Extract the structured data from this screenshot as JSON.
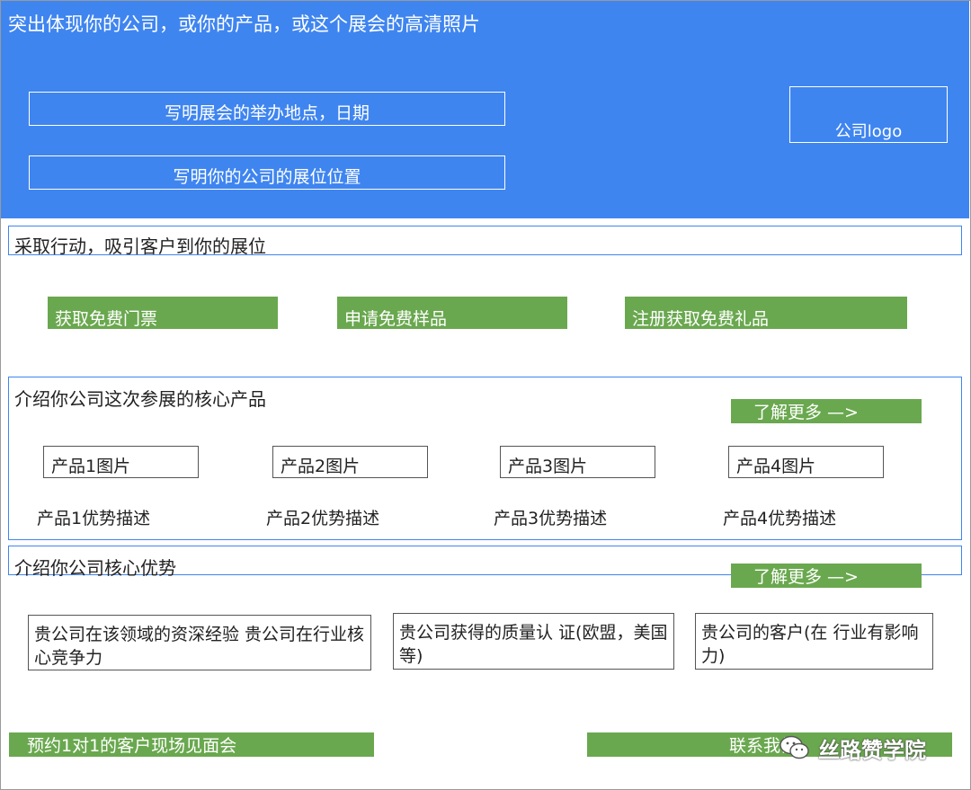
{
  "hero": {
    "title": "突出体现你的公司，或你的产品，或这个展会的高清照片",
    "venue_date": "写明展会的举办地点，日期",
    "booth": "写明你的公司的展位位置",
    "logo": "公司logo"
  },
  "action": {
    "heading": "采取行动，吸引客户到你的展位",
    "buttons": [
      "获取免费门票",
      "申请免费样品",
      "注册获取免费礼品"
    ]
  },
  "products": {
    "heading": "介绍你公司这次参展的核心产品",
    "more": "了解更多 —>",
    "items": [
      {
        "image": "产品1图片",
        "desc": "产品1优势描述"
      },
      {
        "image": "产品2图片",
        "desc": "产品2优势描述"
      },
      {
        "image": "产品3图片",
        "desc": "产品3优势描述"
      },
      {
        "image": "产品4图片",
        "desc": "产品4优势描述"
      }
    ]
  },
  "advantages": {
    "heading": "介绍你公司核心优势",
    "more": "了解更多 —>",
    "items": [
      "贵公司在该领域的资深经验 贵公司在行业核心竞争力",
      "贵公司获得的质量认 证(欧盟，美国等)",
      "贵公司的客户(在 行业有影响力)"
    ]
  },
  "footer": {
    "meeting": "预约1对1的客户现场见面会",
    "contact": "联系我们"
  },
  "watermark": {
    "text": "丝路赞学院",
    "icon": "wechat-icon"
  },
  "colors": {
    "hero": "#3f85f0",
    "accent_green": "#6aa84f",
    "outline_blue": "#3f85f0"
  }
}
